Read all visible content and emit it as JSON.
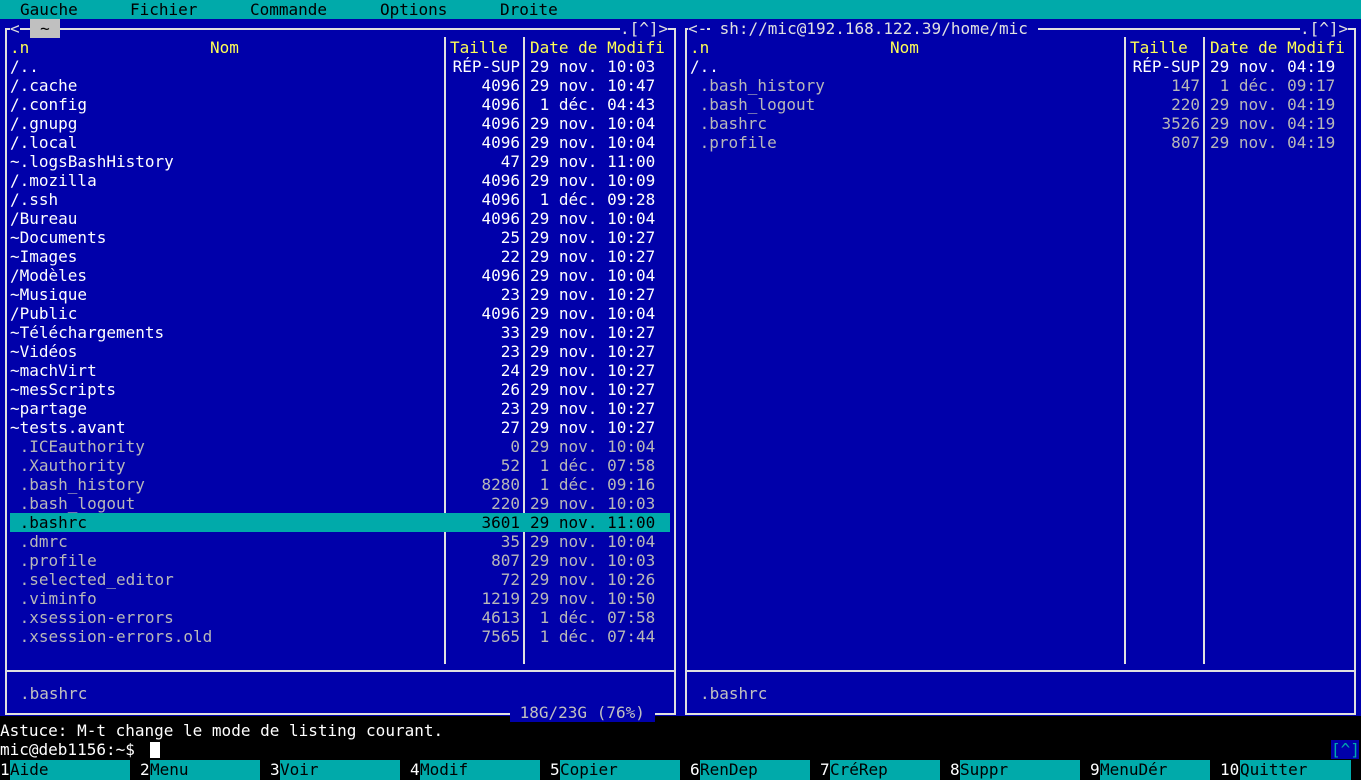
{
  "menubar": {
    "items": [
      "Gauche",
      "Fichier",
      "Commande",
      "Options",
      "Droite"
    ]
  },
  "left_panel": {
    "title": "~",
    "title_left_marker": "<",
    "title_right_marker": ".[^]>",
    "headers": {
      "sort": ".n",
      "name": "Nom",
      "size": "Taille",
      "date": "Date de Modifi"
    },
    "rows": [
      {
        "name": "/..",
        "size": "RÉP-SUP",
        "date": "29 nov. 10:03",
        "kind": "dir"
      },
      {
        "name": "/.cache",
        "size": "4096",
        "date": "29 nov. 10:47",
        "kind": "dir"
      },
      {
        "name": "/.config",
        "size": "4096",
        "date": " 1 déc. 04:43",
        "kind": "dir"
      },
      {
        "name": "/.gnupg",
        "size": "4096",
        "date": "29 nov. 10:04",
        "kind": "dir"
      },
      {
        "name": "/.local",
        "size": "4096",
        "date": "29 nov. 10:04",
        "kind": "dir"
      },
      {
        "name": "~.logsBashHistory",
        "size": "47",
        "date": "29 nov. 11:00",
        "kind": "dir"
      },
      {
        "name": "/.mozilla",
        "size": "4096",
        "date": "29 nov. 10:09",
        "kind": "dir"
      },
      {
        "name": "/.ssh",
        "size": "4096",
        "date": " 1 déc. 09:28",
        "kind": "dir"
      },
      {
        "name": "/Bureau",
        "size": "4096",
        "date": "29 nov. 10:04",
        "kind": "dir"
      },
      {
        "name": "~Documents",
        "size": "25",
        "date": "29 nov. 10:27",
        "kind": "dir"
      },
      {
        "name": "~Images",
        "size": "22",
        "date": "29 nov. 10:27",
        "kind": "dir"
      },
      {
        "name": "/Modèles",
        "size": "4096",
        "date": "29 nov. 10:04",
        "kind": "dir"
      },
      {
        "name": "~Musique",
        "size": "23",
        "date": "29 nov. 10:27",
        "kind": "dir"
      },
      {
        "name": "/Public",
        "size": "4096",
        "date": "29 nov. 10:04",
        "kind": "dir"
      },
      {
        "name": "~Téléchargements",
        "size": "33",
        "date": "29 nov. 10:27",
        "kind": "dir"
      },
      {
        "name": "~Vidéos",
        "size": "23",
        "date": "29 nov. 10:27",
        "kind": "dir"
      },
      {
        "name": "~machVirt",
        "size": "24",
        "date": "29 nov. 10:27",
        "kind": "dir"
      },
      {
        "name": "~mesScripts",
        "size": "26",
        "date": "29 nov. 10:27",
        "kind": "dir"
      },
      {
        "name": "~partage",
        "size": "23",
        "date": "29 nov. 10:27",
        "kind": "dir"
      },
      {
        "name": "~tests.avant",
        "size": "27",
        "date": "29 nov. 10:27",
        "kind": "dir"
      },
      {
        "name": " .ICEauthority",
        "size": "0",
        "date": "29 nov. 10:04",
        "kind": "file"
      },
      {
        "name": " .Xauthority",
        "size": "52",
        "date": " 1 déc. 07:58",
        "kind": "file"
      },
      {
        "name": " .bash_history",
        "size": "8280",
        "date": " 1 déc. 09:16",
        "kind": "file"
      },
      {
        "name": " .bash_logout",
        "size": "220",
        "date": "29 nov. 10:03",
        "kind": "file"
      },
      {
        "name": " .bashrc",
        "size": "3601",
        "date": "29 nov. 11:00",
        "kind": "selected"
      },
      {
        "name": " .dmrc",
        "size": "35",
        "date": "29 nov. 10:04",
        "kind": "file"
      },
      {
        "name": " .profile",
        "size": "807",
        "date": "29 nov. 10:03",
        "kind": "file"
      },
      {
        "name": " .selected_editor",
        "size": "72",
        "date": "29 nov. 10:26",
        "kind": "file"
      },
      {
        "name": " .viminfo",
        "size": "1219",
        "date": "29 nov. 10:50",
        "kind": "file"
      },
      {
        "name": " .xsession-errors",
        "size": "4613",
        "date": " 1 déc. 07:58",
        "kind": "file"
      },
      {
        "name": " .xsession-errors.old",
        "size": "7565",
        "date": " 1 déc. 07:44",
        "kind": "file"
      }
    ],
    "status_file": ".bashrc",
    "disk_usage": " 18G/23G (76%) "
  },
  "right_panel": {
    "title": " sh://mic@192.168.122.39/home/mic ",
    "title_left_marker": "<-",
    "title_right_marker": ".[^]>",
    "headers": {
      "sort": ".n",
      "name": "Nom",
      "size": "Taille",
      "date": "Date de Modifi"
    },
    "rows": [
      {
        "name": "/..",
        "size": "RÉP-SUP",
        "date": "29 nov. 04:19",
        "kind": "dir"
      },
      {
        "name": " .bash_history",
        "size": "147",
        "date": " 1 déc. 09:17",
        "kind": "file"
      },
      {
        "name": " .bash_logout",
        "size": "220",
        "date": "29 nov. 04:19",
        "kind": "file"
      },
      {
        "name": " .bashrc",
        "size": "3526",
        "date": "29 nov. 04:19",
        "kind": "file"
      },
      {
        "name": " .profile",
        "size": "807",
        "date": "29 nov. 04:19",
        "kind": "file"
      }
    ],
    "status_file": ".bashrc"
  },
  "hint": "Astuce: M-t change le mode de listing courant.",
  "prompt": "mic@deb1156:~$ ",
  "history_button": "[^]",
  "fkeys": [
    {
      "num": "1",
      "label": "Aide"
    },
    {
      "num": "2",
      "label": "Menu"
    },
    {
      "num": "3",
      "label": "Voir"
    },
    {
      "num": "4",
      "label": "Modif"
    },
    {
      "num": "5",
      "label": "Copier"
    },
    {
      "num": "6",
      "label": "RenDep"
    },
    {
      "num": "7",
      "label": "CréRep"
    },
    {
      "num": "8",
      "label": "Suppr"
    },
    {
      "num": "9",
      "label": "MenuDér"
    },
    {
      "num": "10",
      "label": "Quitter"
    }
  ],
  "colors": {
    "panel_bg": "#0000aa",
    "menubar_bg": "#00aaaa",
    "header_fg": "#ffff55",
    "selection_bg": "#00aaaa"
  }
}
